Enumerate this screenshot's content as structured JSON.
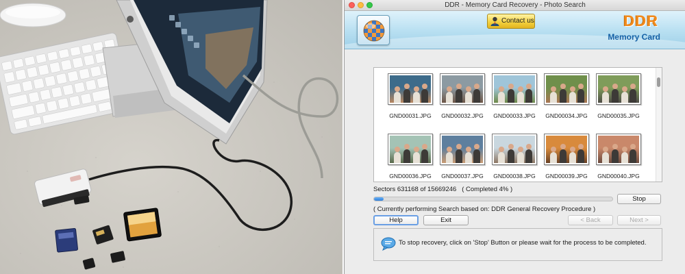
{
  "window": {
    "title": "DDR - Memory Card Recovery - Photo Search"
  },
  "banner": {
    "contact_label": "Contact us",
    "brand_name": "DDR",
    "brand_subtitle": "Memory Card"
  },
  "results": {
    "files": [
      {
        "name": "GND00031.JPG",
        "tone": [
          "#3d6b8a",
          "#b98760"
        ]
      },
      {
        "name": "GND00032.JPG",
        "tone": [
          "#8c9aa2",
          "#6e5647"
        ]
      },
      {
        "name": "GND00033.JPG",
        "tone": [
          "#9fc5d9",
          "#6e8a4a"
        ]
      },
      {
        "name": "GND00034.JPG",
        "tone": [
          "#6f8f4b",
          "#a97552"
        ]
      },
      {
        "name": "GND00035.JPG",
        "tone": [
          "#7f9c5a",
          "#4e4c47"
        ]
      },
      {
        "name": "GND00036.JPG",
        "tone": [
          "#a4c3b5",
          "#5a6a4b"
        ]
      },
      {
        "name": "GND00037.JPG",
        "tone": [
          "#5e7f9e",
          "#c99b73"
        ]
      },
      {
        "name": "GND00038.JPG",
        "tone": [
          "#c9d7df",
          "#8c7663"
        ]
      },
      {
        "name": "GND00039.JPG",
        "tone": [
          "#d88a3c",
          "#6a4126"
        ]
      },
      {
        "name": "GND00040.JPG",
        "tone": [
          "#c9886a",
          "#6b4a3e"
        ]
      }
    ]
  },
  "progress": {
    "sectors_text": "Sectors 631168 of 15669246",
    "completed_text": "( Completed 4% )",
    "percent": 4,
    "status_text": "( Currently performing Search based on: DDR General Recovery Procedure )"
  },
  "buttons": {
    "stop": "Stop",
    "help": "Help",
    "exit": "Exit",
    "back": "< Back",
    "next": "Next >"
  },
  "message": {
    "text": "To stop recovery, click on 'Stop' Button or please wait for the process to be completed."
  },
  "icons": {
    "logo": "ddr-logo-icon",
    "contact": "person-icon",
    "message": "speech-bubble-icon"
  },
  "colors": {
    "brand_orange": "#f08a1c",
    "brand_blue": "#1561a6",
    "progress_blue": "#2e7fdb",
    "contact_gold": "#f2cf3c"
  }
}
